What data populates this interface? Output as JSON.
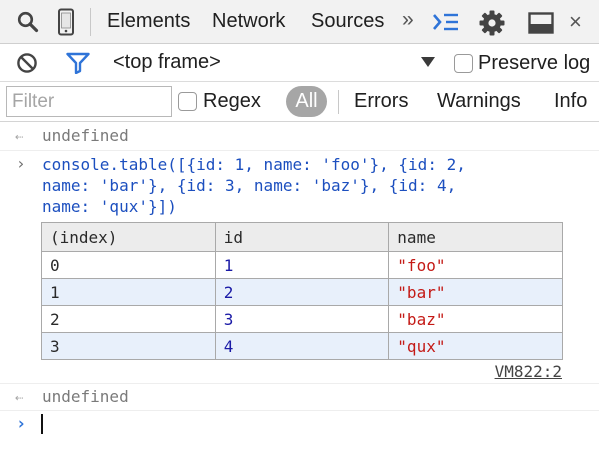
{
  "toolbar": {
    "tabs": [
      {
        "label": "Elements"
      },
      {
        "label": "Network"
      },
      {
        "label": "Sources"
      }
    ],
    "more_label": "»",
    "icons": [
      "search-icon",
      "device-mode-icon",
      "console-drawer-icon",
      "gear-icon",
      "dock-icon",
      "close-icon"
    ],
    "close_label": "×"
  },
  "console_toolbar": {
    "frame_context": "<top frame>",
    "preserve_log_label": "Preserve log",
    "preserve_log_checked": false
  },
  "filter_bar": {
    "filter_placeholder": "Filter",
    "regex_label": "Regex",
    "regex_checked": false,
    "levels": [
      "All",
      "Errors",
      "Warnings",
      "Info"
    ],
    "active_level": "All"
  },
  "console": {
    "result1": "undefined",
    "command_lines": [
      "console.table([{id: 1, name: 'foo'}, {id: 2,",
      "name: 'bar'}, {id: 3, name: 'baz'}, {id: 4,",
      "name: 'qux'}])"
    ],
    "table": {
      "headers": [
        "(index)",
        "id",
        "name"
      ],
      "rows": [
        [
          "0",
          "1",
          "\"foo\""
        ],
        [
          "1",
          "2",
          "\"bar\""
        ],
        [
          "2",
          "3",
          "\"baz\""
        ],
        [
          "3",
          "4",
          "\"qux\""
        ]
      ]
    },
    "source_link": "VM822:2",
    "result2": "undefined"
  },
  "colors": {
    "command_text": "#1c4fbf",
    "number_value": "#1a1aa6",
    "string_value": "#c41a16",
    "active_pill": "#a6a6a6",
    "prompt_arrow": "#2f74d8",
    "filter_icon": "#2f74d8"
  }
}
